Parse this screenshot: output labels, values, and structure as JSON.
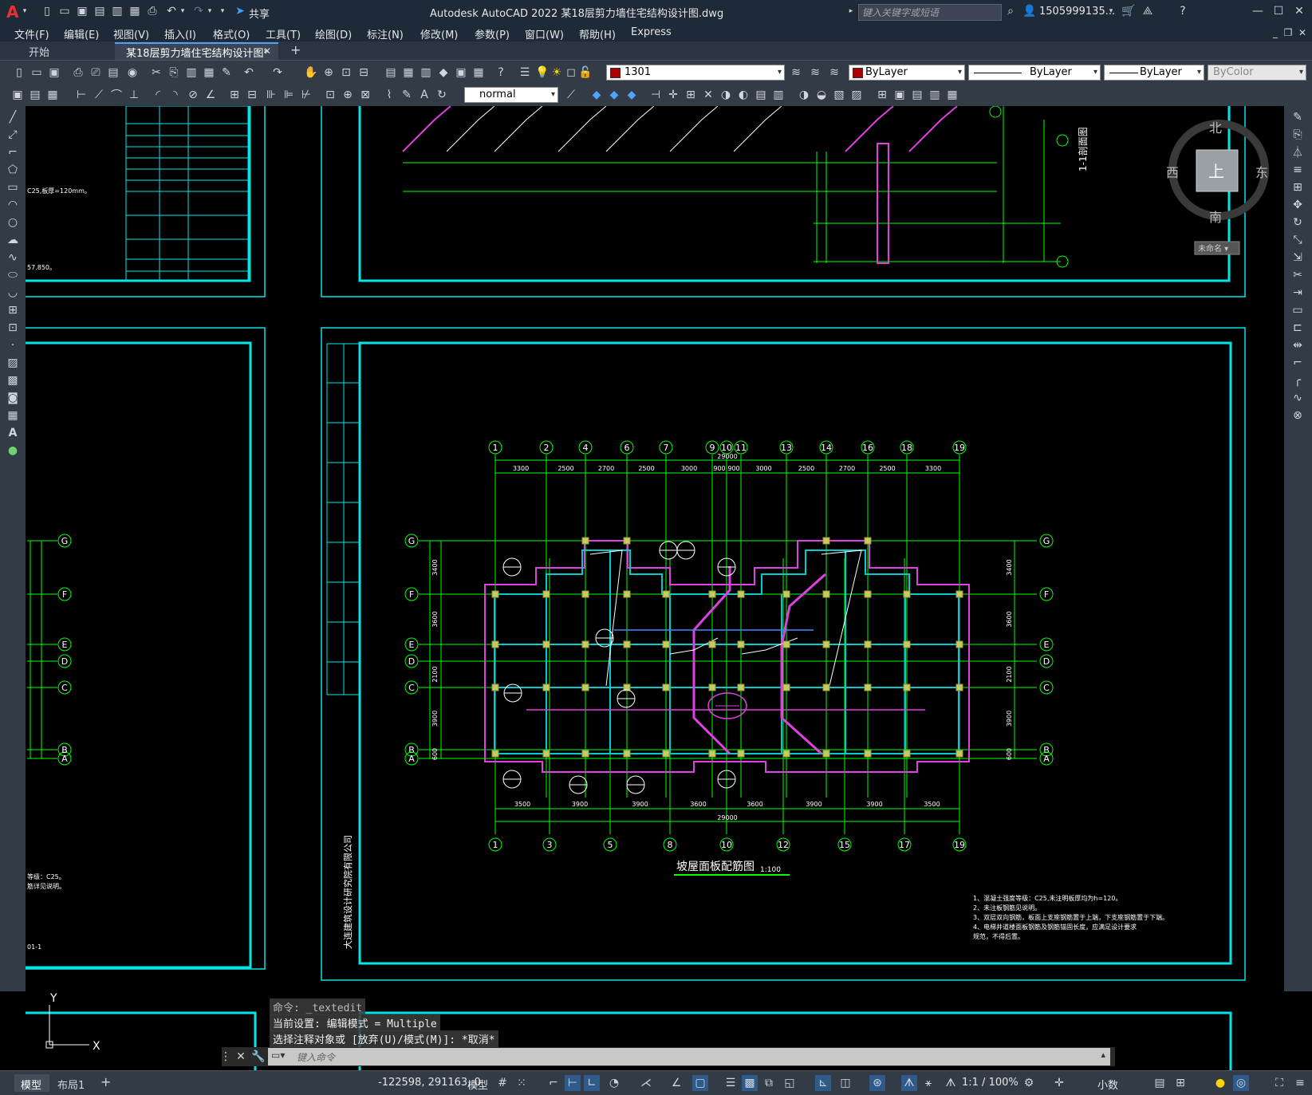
{
  "app": {
    "logo": "A",
    "title": "Autodesk AutoCAD 2022    某18层剪力墙住宅结构设计图.dwg",
    "share_label": "共享",
    "search_placeholder": "键入关键字或短语",
    "user": "1505999135...",
    "window_controls": [
      "—",
      "☐",
      "✕"
    ]
  },
  "menu": {
    "items": [
      "文件(F)",
      "编辑(E)",
      "视图(V)",
      "插入(I)",
      "格式(O)",
      "工具(T)",
      "绘图(D)",
      "标注(N)",
      "修改(M)",
      "参数(P)",
      "窗口(W)",
      "帮助(H)",
      "Express"
    ]
  },
  "tabs": {
    "start": "开始",
    "active": "某18层剪力墙住宅结构设计图*",
    "close": "✕",
    "add": "+"
  },
  "toolbar": {
    "layer_name": "1301",
    "color": "ByLayer",
    "linetype": "ByLayer",
    "lineweight": "ByLayer",
    "plotstyle": "ByColor",
    "text_style": "normal"
  },
  "viewcube": {
    "north": "北",
    "south": "南",
    "east": "东",
    "west": "西",
    "top": "上",
    "wcs": "未命名 ▾"
  },
  "drawing": {
    "plan_title": "坡屋面板配筋图",
    "plan_scale": "1:100",
    "section_title": "1-1剖面图",
    "top_axis_labels": [
      "1",
      "2",
      "4",
      "6",
      "7",
      "9",
      "10",
      "11",
      "13",
      "14",
      "16",
      "18",
      "19"
    ],
    "bottom_axis_labels": [
      "1",
      "3",
      "5",
      "8",
      "10",
      "12",
      "15",
      "17",
      "19"
    ],
    "row_axis_labels": [
      "G",
      "F",
      "E",
      "D",
      "C",
      "B",
      "A"
    ],
    "top_dims": [
      "3300",
      "2500",
      "2700",
      "2500",
      "3000",
      "900",
      "900",
      "3000",
      "2500",
      "2700",
      "2500",
      "3300"
    ],
    "top_total": "29000",
    "bottom_dims": [
      "3500",
      "3900",
      "3900",
      "3600",
      "3600",
      "3900",
      "3900",
      "3500"
    ],
    "bottom_total": "29000",
    "left_dims": [
      "3400",
      "3600",
      "2100",
      "3900",
      "600"
    ],
    "notes": [
      "1、混凝土强度等级：C25,未注明板厚均为h=120。",
      "2、未注板钢筋见说明。",
      "3、双层双向钢筋，板面上支座钢筋置于上端，下支座钢筋置于下端。",
      "4、电梯井道楼面板钢筋及钢筋锚固长度，应满足设计要求",
      "   规范，不得后置。"
    ],
    "left_notes": [
      "C25,板厚=120mm。",
      "57.850。"
    ],
    "bottom_left_notes": [
      "等级：C25。",
      "筋详见说明。",
      "01-1"
    ],
    "stamp": "大连建筑设计研究院有限公司"
  },
  "command": {
    "line1": "命令: _textedit",
    "line2": "当前设置: 编辑模式 = Multiple",
    "line3": "选择注释对象或 [放弃(U)/模式(M)]: *取消*",
    "placeholder": "键入命令"
  },
  "ucs": {
    "y": "Y",
    "x": "X"
  },
  "status": {
    "tab_model": "模型",
    "tab_layout": "布局1",
    "add": "+",
    "coords": "-122598, 291163, 0",
    "model": "模型",
    "scale": "1:1 / 100%",
    "units": "小数"
  },
  "colors": {
    "accent_cyan": "#00e6e6",
    "green_lines": "#00ff00",
    "magenta": "#e040e0",
    "frame_bg": "#000000"
  }
}
